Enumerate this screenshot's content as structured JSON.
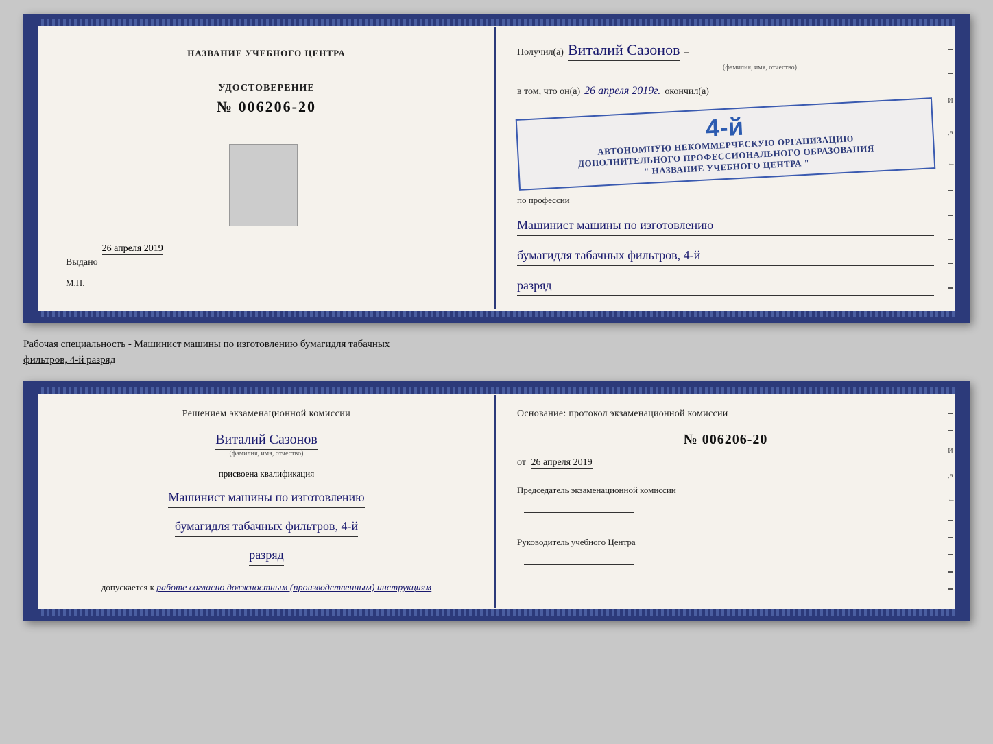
{
  "doc_top": {
    "left": {
      "training_center_label": "НАЗВАНИЕ УЧЕБНОГО ЦЕНТРА",
      "udostoverenie_label": "УДОСТОВЕРЕНИЕ",
      "number": "№ 006206-20",
      "vydano_label": "Выдано",
      "vydano_date": "26 апреля 2019",
      "mp_label": "М.П."
    },
    "right": {
      "poluchil_prefix": "Получил(а)",
      "name_handwritten": "Виталий Сазонов",
      "name_sub": "(фамилия, имя, отчество)",
      "dash": "–",
      "vtom_prefix": "в том, что он(а)",
      "date_handwritten": "26 апреля 2019г.",
      "okonchil": "окончил(а)",
      "stamp_line1": "АВТОНОМНУЮ НЕКОММЕРЧЕСКУЮ ОРГАНИЗАЦИЮ",
      "stamp_line2": "ДОПОЛНИТЕЛЬНОГО ПРОФЕССИОНАЛЬНОГО ОБРАЗОВАНИЯ",
      "stamp_line3": "\" НАЗВАНИЕ УЧЕБНОГО ЦЕНТРА \"",
      "stamp_number": "4-й",
      "po_professii": "по профессии",
      "profession1": "Машинист машины по изготовлению",
      "profession2": "бумагидля табачных фильтров, 4-й",
      "profession3": "разряд"
    }
  },
  "between_label": {
    "text1": "Рабочая специальность - Машинист машины по изготовлению бумагидля табачных",
    "text2": "фильтров, 4-й разряд"
  },
  "doc_bottom": {
    "left": {
      "reshenie_label": "Решением  экзаменационной  комиссии",
      "name_handwritten": "Виталий Сазонов",
      "name_sub": "(фамилия, имя, отчество)",
      "prisvoena": "присвоена квалификация",
      "qual1": "Машинист машины по изготовлению",
      "qual2": "бумагидля табачных фильтров, 4-й",
      "qual3": "разряд",
      "dopuskaetsya_prefix": "допускается к",
      "dopuskaetsya_val": "работе согласно должностным (производственным) инструкциям"
    },
    "right": {
      "osnovaniye": "Основание: протокол экзаменационной  комиссии",
      "protokol_number": "№  006206-20",
      "ot_prefix": "от",
      "ot_date": "26 апреля 2019",
      "predsedatel_label": "Председатель экзаменационной комиссии",
      "rukovoditel_label": "Руководитель учебного Центра"
    }
  },
  "side_chars": {
    "и": "и",
    "а": "а",
    "left_arrow": "←",
    "dashes": [
      "–",
      "–",
      "–",
      "–",
      "–"
    ]
  }
}
